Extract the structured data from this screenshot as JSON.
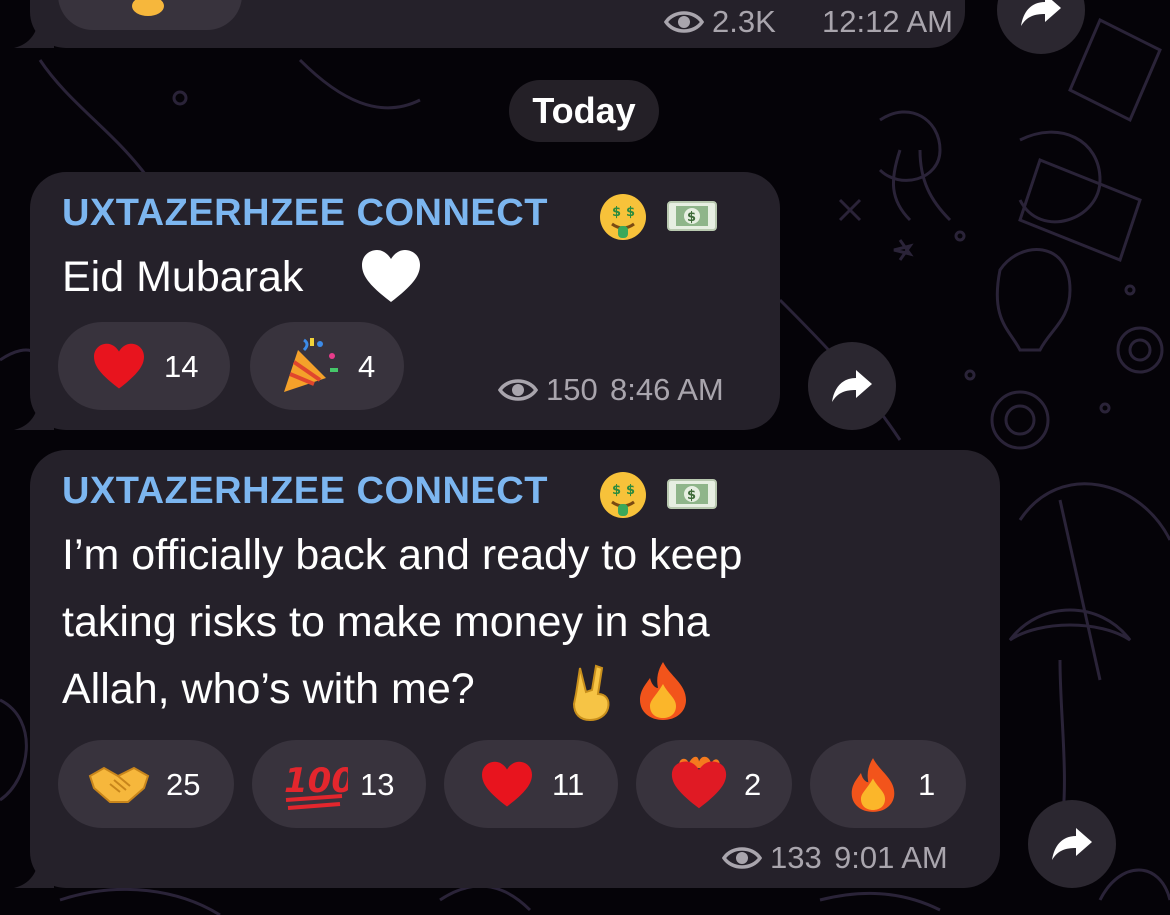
{
  "date_separator": "Today",
  "previous_message": {
    "views": "2.3K",
    "time": "12:12 AM"
  },
  "messages": [
    {
      "sender": "UXTAZERHZEE CONNECT",
      "sender_emojis": [
        "money-mouth-face",
        "dollar-banknote"
      ],
      "text_lines": [
        "Eid Mubarak"
      ],
      "text_emoji": "white-heart",
      "reactions": [
        {
          "emoji": "red-heart",
          "count": "14"
        },
        {
          "emoji": "party-popper",
          "count": "4"
        }
      ],
      "views": "150",
      "time": "8:46 AM"
    },
    {
      "sender": "UXTAZERHZEE CONNECT",
      "sender_emojis": [
        "money-mouth-face",
        "dollar-banknote"
      ],
      "text_lines": [
        "I’m officially back and ready to keep",
        "taking risks to make money in sha",
        "Allah, who’s with me?"
      ],
      "text_emojis": [
        "victory-hand",
        "fire"
      ],
      "reactions": [
        {
          "emoji": "handshake",
          "count": "25"
        },
        {
          "emoji": "hundred-points",
          "count": "13"
        },
        {
          "emoji": "red-heart",
          "count": "11"
        },
        {
          "emoji": "heart-on-fire",
          "count": "2"
        },
        {
          "emoji": "fire",
          "count": "1"
        }
      ],
      "views": "133",
      "time": "9:01 AM"
    }
  ],
  "colors": {
    "background": "#050308",
    "bubble": "#25212a",
    "reaction_pill": "#38333d",
    "sender_name": "#7cb6f0",
    "meta_text": "#a9a5ad",
    "doodle_stroke": "#2a2338"
  }
}
